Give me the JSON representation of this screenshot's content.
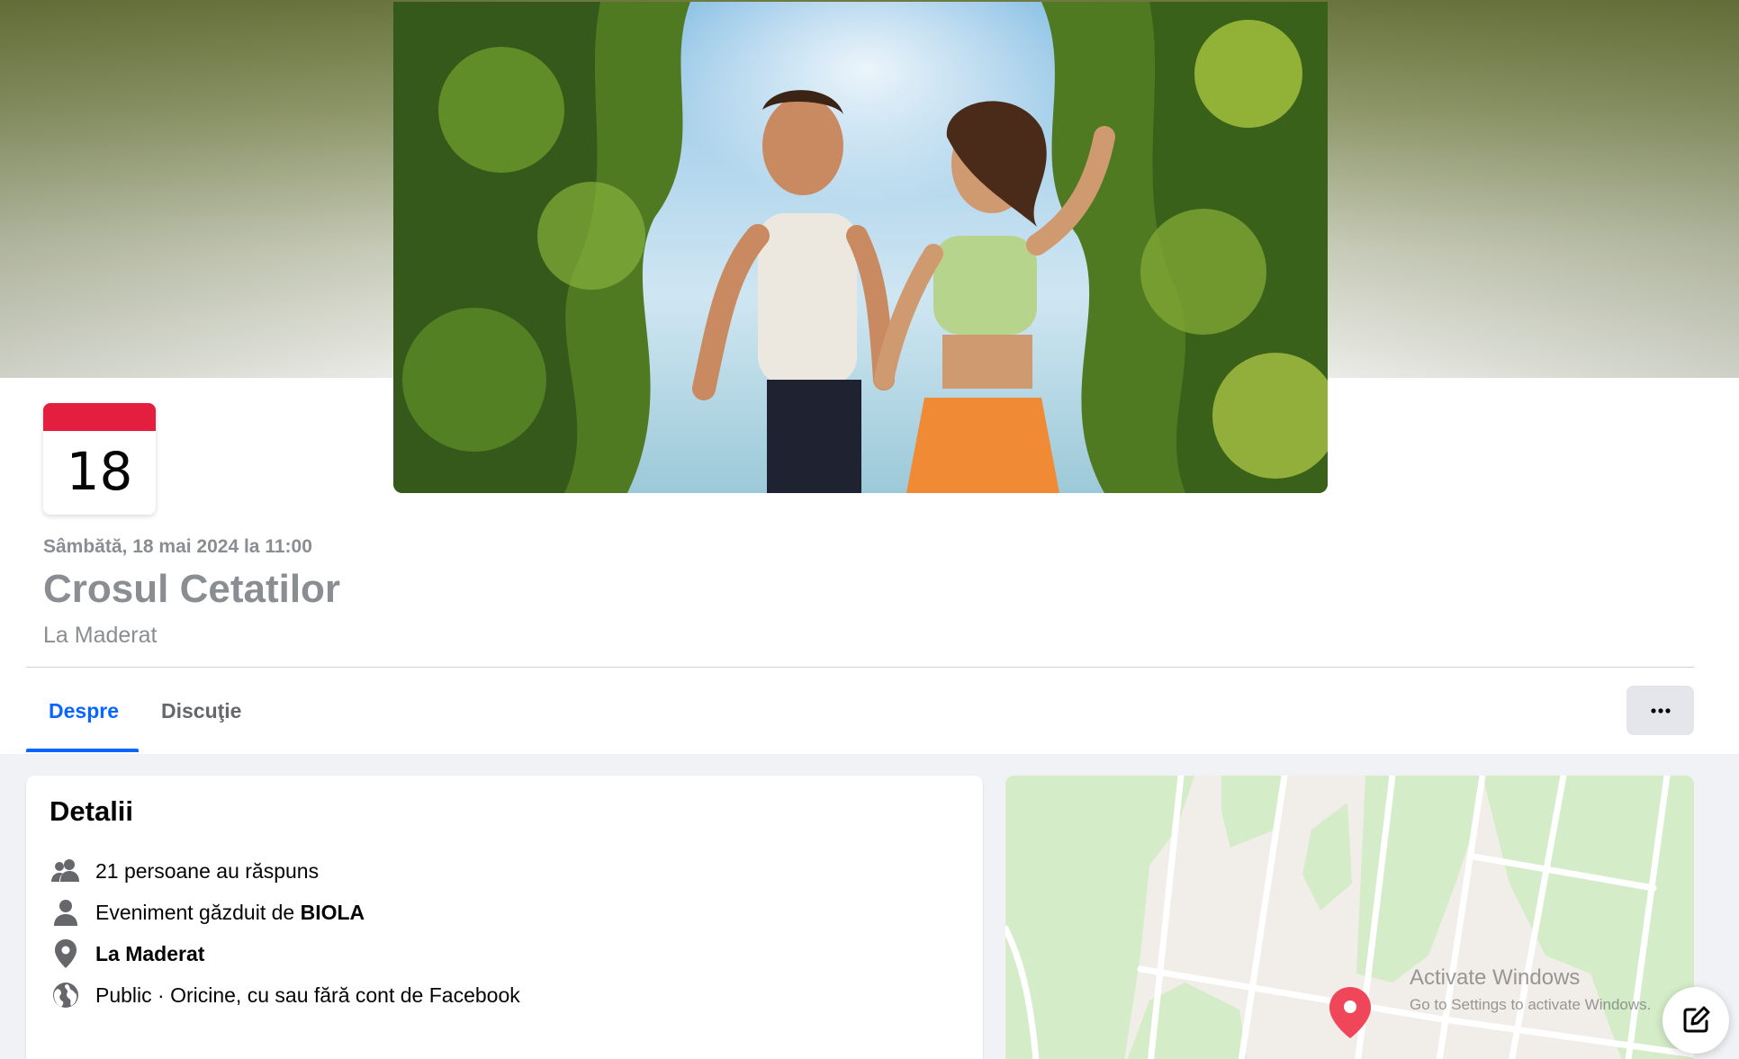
{
  "event": {
    "calendar_day": "18",
    "datetime": "Sâmbătă, 18 mai 2024 la 11:00",
    "title": "Crosul Cetatilor",
    "location": "La Maderat"
  },
  "tabs": [
    {
      "label": "Despre",
      "active": true
    },
    {
      "label": "Discuţie",
      "active": false
    }
  ],
  "more_button": {
    "icon": "more-horizontal-icon",
    "label": "···"
  },
  "details": {
    "heading": "Detalii",
    "responses": "21 persoane au răspuns",
    "host_prefix": "Eveniment găzduit de ",
    "host_name": "BIOLA",
    "location": "La Maderat",
    "privacy": "Public · Oricine, cu sau fără cont de Facebook"
  },
  "watermark": {
    "title": "Activate Windows",
    "subtitle": "Go to Settings to activate Windows."
  },
  "colors": {
    "accent": "#0866ff",
    "calendar_red": "#e41e3f",
    "map_pin": "#f0465a",
    "map_green": "#d4ecc8"
  }
}
